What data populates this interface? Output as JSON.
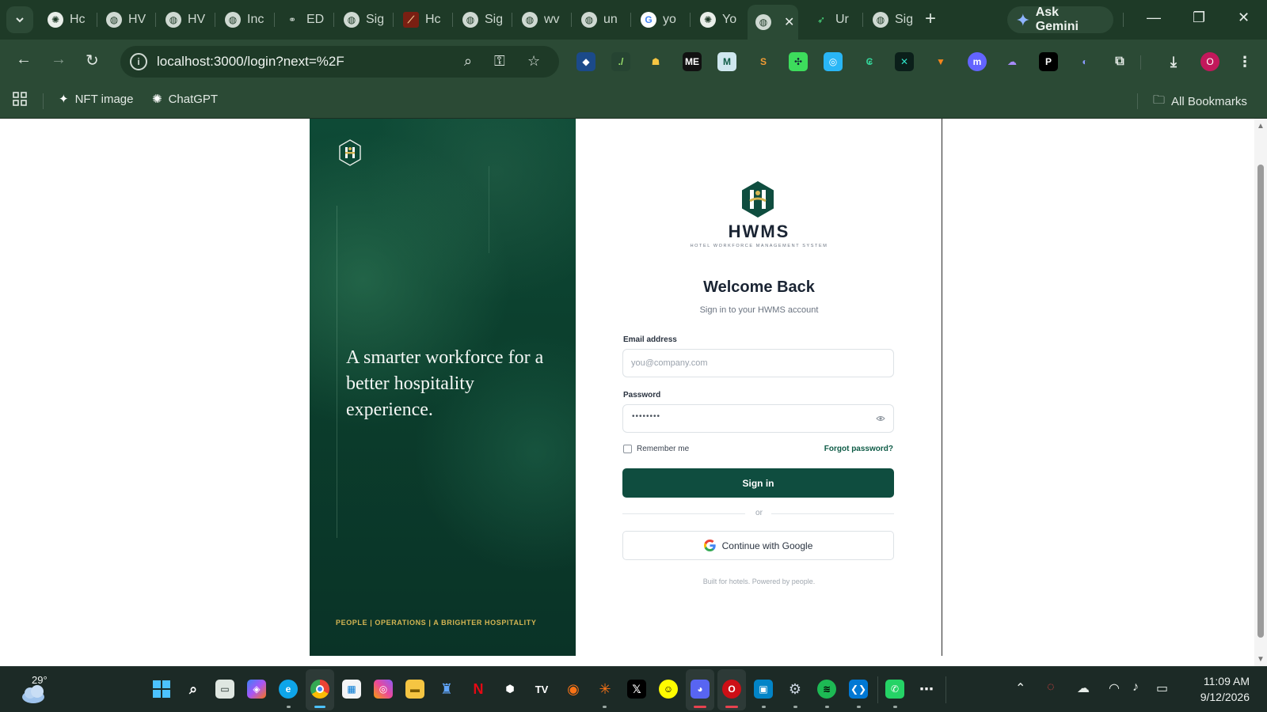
{
  "browser": {
    "tabs": [
      {
        "title": "Hc",
        "icon": "chatgpt-icon"
      },
      {
        "title": "HV",
        "icon": "globe-icon"
      },
      {
        "title": "HV",
        "icon": "globe-icon"
      },
      {
        "title": "Inc",
        "icon": "globe-icon"
      },
      {
        "title": "ED",
        "icon": "link-icon"
      },
      {
        "title": "Sig",
        "icon": "globe-icon"
      },
      {
        "title": "Hc",
        "icon": "app-icon"
      },
      {
        "title": "Sig",
        "icon": "globe-icon"
      },
      {
        "title": "wv",
        "icon": "globe-icon"
      },
      {
        "title": "un",
        "icon": "globe-icon"
      },
      {
        "title": "yo",
        "icon": "google-icon"
      },
      {
        "title": "Yo",
        "icon": "chatgpt-icon"
      },
      {
        "title": "",
        "icon": "globe-icon",
        "active": true
      },
      {
        "title": "Ur",
        "icon": "bolt-icon"
      },
      {
        "title": "Sig",
        "icon": "globe-icon"
      }
    ],
    "gemini_label": "Ask Gemini",
    "url": "localhost:3000/login?next=%2F",
    "bookmarks": [
      {
        "label": "NFT image",
        "icon": "nft-icon"
      },
      {
        "label": "ChatGPT",
        "icon": "chatgpt-icon"
      }
    ],
    "all_bookmarks_label": "All Bookmarks",
    "profile_initial": "O"
  },
  "hero": {
    "tagline": "A smarter workforce for a better hospitality experience.",
    "footer": "PEOPLE | OPERATIONS | A BRIGHTER HOSPITALITY"
  },
  "login": {
    "brand_name": "HWMS",
    "brand_subtitle": "HOTEL WORKFORCE MANAGEMENT SYSTEM",
    "title": "Welcome Back",
    "subtitle": "Sign in to your HWMS account",
    "email_label": "Email address",
    "email_placeholder": "you@company.com",
    "password_label": "Password",
    "password_masked": "••••••••",
    "remember_label": "Remember me",
    "forgot_label": "Forgot password?",
    "signin_label": "Sign in",
    "divider_label": "or",
    "google_label": "Continue with Google",
    "footnote": "Built for hotels. Powered by people."
  },
  "taskbar": {
    "temperature": "29°",
    "time": "11:09 AM",
    "date": "9/12/2026"
  },
  "colors": {
    "chrome_bg": "#1e3a27",
    "toolbar_bg": "#2b4a35",
    "brand_green": "#0f4d3f",
    "hero_gold": "#d4b553"
  }
}
